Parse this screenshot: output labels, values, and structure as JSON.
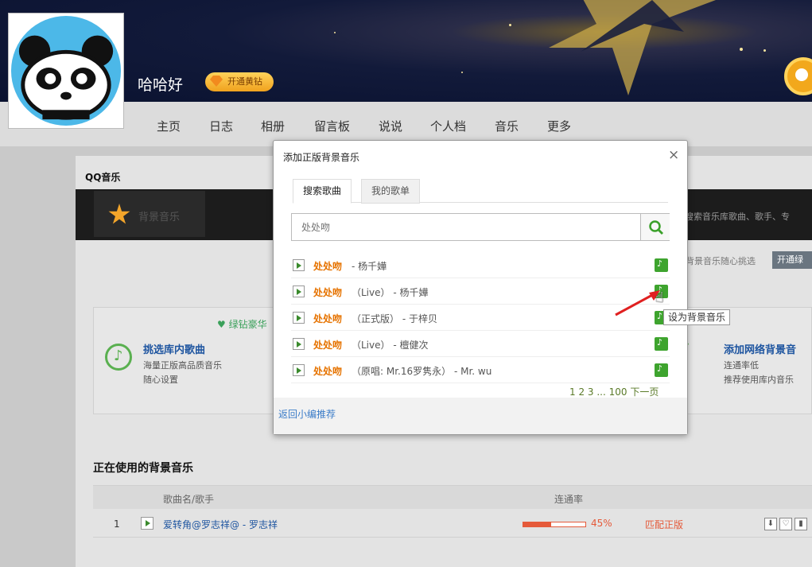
{
  "profile": {
    "username": "哈哈好",
    "vip_badge": "开通黄钻"
  },
  "nav": {
    "items": [
      "主页",
      "日志",
      "相册",
      "留言板",
      "说说",
      "个人档",
      "音乐",
      "更多"
    ]
  },
  "qq_music": {
    "title": "QQ音乐",
    "tab_label": "背景音乐",
    "bar_search_hint": "搜索音乐库歌曲、歌手、专",
    "promo_text": "背景音乐随心挑选",
    "promo_button": "开通绿"
  },
  "panel": {
    "green_diamond_label": "绿钻豪华",
    "library_title": "挑选库内歌曲",
    "library_desc1": "海量正版高品质音乐",
    "library_desc2": "随心设置",
    "network_title": "添加网络背景音",
    "network_desc1": "连通率低",
    "network_desc2": "推荐使用库内音乐"
  },
  "using": {
    "title": "正在使用的背景音乐",
    "col_name": "歌曲名/歌手",
    "col_rate": "连通率",
    "row": {
      "num": "1",
      "song": "爱转角@罗志祥@ - 罗志祥",
      "rate_text": "45%",
      "rate_value": 0.45,
      "status": "匹配正版"
    }
  },
  "modal": {
    "title": "添加正版背景音乐",
    "close": "×",
    "tab_search": "搜索歌曲",
    "tab_playlist": "我的歌单",
    "search_placeholder": "处处吻",
    "results": [
      {
        "title": "处处吻",
        "rest": "- 杨千嬅"
      },
      {
        "title": "处处吻",
        "rest": "（Live） - 杨千嬅"
      },
      {
        "title": "处处吻",
        "rest": "（正式版） - 于梓贝"
      },
      {
        "title": "处处吻",
        "rest": "（Live） - 檀健次"
      },
      {
        "title": "处处吻",
        "rest": "（原唱: Mr.16罗隽永） - Mr. wu"
      }
    ],
    "pager": "1 2 3 ... 100 下一页",
    "back_link": "返回小编推荐",
    "tooltip": "设为背景音乐"
  }
}
